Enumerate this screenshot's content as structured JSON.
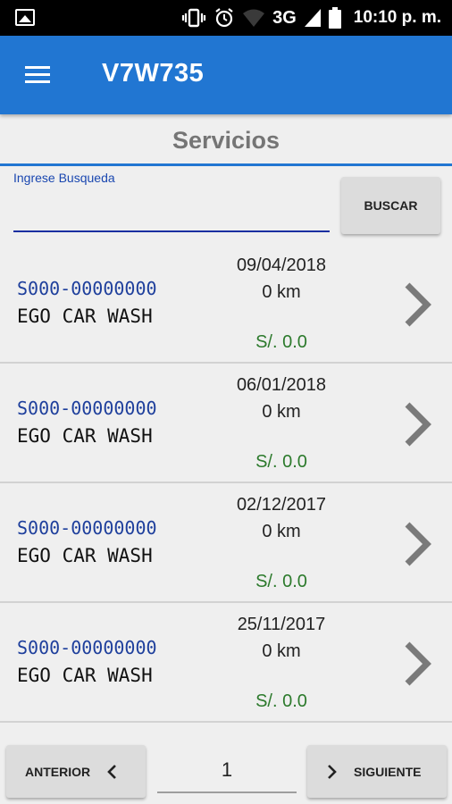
{
  "status_bar": {
    "network": "3G",
    "time": "10:10 p. m.",
    "icons": [
      "image-icon",
      "vibrate-icon",
      "alarm-icon",
      "wifi-icon",
      "signal-icon",
      "battery-icon"
    ]
  },
  "app_bar": {
    "title": "V7W735",
    "background_color": "#2176d2"
  },
  "section": {
    "title": "Servicios"
  },
  "search": {
    "label": "Ingrese Busqueda",
    "value": "",
    "button_label": "BUSCAR"
  },
  "services": [
    {
      "code": "S000-00000000",
      "name": "EGO CAR WASH",
      "date": "09/04/2018",
      "km": "0 km",
      "amount": "S/. 0.0"
    },
    {
      "code": "S000-00000000",
      "name": "EGO CAR WASH",
      "date": "06/01/2018",
      "km": "0 km",
      "amount": "S/. 0.0"
    },
    {
      "code": "S000-00000000",
      "name": "EGO CAR WASH",
      "date": "02/12/2017",
      "km": "0 km",
      "amount": "S/. 0.0"
    },
    {
      "code": "S000-00000000",
      "name": "EGO CAR WASH",
      "date": "25/11/2017",
      "km": "0 km",
      "amount": "S/. 0.0"
    }
  ],
  "pagination": {
    "prev_label": "ANTERIOR",
    "next_label": "SIGUIENTE",
    "page": "1"
  },
  "colors": {
    "code_text": "#1e3f9c",
    "amount_text": "#2c7a2c",
    "accent": "#2176d2"
  }
}
